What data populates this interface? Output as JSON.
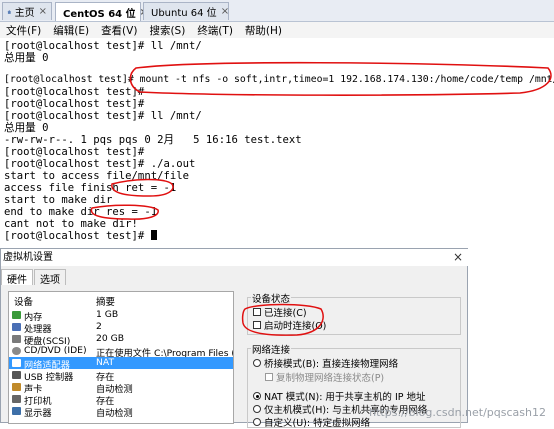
{
  "tabs": [
    {
      "label": "主页",
      "active": false
    },
    {
      "label": "CentOS 64 位",
      "active": true
    },
    {
      "label": "Ubuntu 64 位",
      "active": false
    }
  ],
  "menu": [
    "文件(F)",
    "编辑(E)",
    "查看(V)",
    "搜索(S)",
    "终端(T)",
    "帮助(H)"
  ],
  "terminal": {
    "lines": [
      "[root@localhost test]# ll /mnt/",
      "总用量 0",
      "[root@localhost test]# mount -t nfs -o soft,intr,timeo=1 192.168.174.130:/home/code/temp /mnt/",
      "[root@localhost test]#",
      "[root@localhost test]#",
      "[root@localhost test]# ll /mnt/",
      "总用量 0",
      "-rw-rw-r--. 1 pqs pqs 0 2月   5 16:16 test.text",
      "[root@localhost test]#",
      "[root@localhost test]# ./a.out",
      "start to access file/mnt/file",
      "access file finish ret = -1",
      "start to make dir",
      "end to make dir res = -1",
      "cant not to make dir!",
      "[root@localhost test]# "
    ]
  },
  "dialog": {
    "title": "虚拟机设置",
    "tabs": [
      "硬件",
      "选项"
    ],
    "hardware": {
      "headers": [
        "设备",
        "摘要"
      ],
      "rows": [
        {
          "device": "内存",
          "summary": "1 GB",
          "icon": "memory-icon",
          "color": "#3a9a3a"
        },
        {
          "device": "处理器",
          "summary": "2",
          "icon": "cpu-icon",
          "color": "#4a6fb5"
        },
        {
          "device": "硬盘(SCSI)",
          "summary": "20 GB",
          "icon": "disk-icon",
          "color": "#7a7a7a"
        },
        {
          "device": "CD/DVD (IDE)",
          "summary": "正在使用文件 C:\\Program Files (x86...",
          "icon": "cd-icon",
          "color": "#8a8a8a"
        },
        {
          "device": "网络适配器",
          "summary": "NAT",
          "icon": "network-icon",
          "color": "#2f6bbf",
          "selected": true
        },
        {
          "device": "USB 控制器",
          "summary": "存在",
          "icon": "usb-icon",
          "color": "#555555"
        },
        {
          "device": "声卡",
          "summary": "自动检测",
          "icon": "sound-icon",
          "color": "#c08a2a"
        },
        {
          "device": "打印机",
          "summary": "存在",
          "icon": "printer-icon",
          "color": "#666666"
        },
        {
          "device": "显示器",
          "summary": "自动检测",
          "icon": "monitor-icon",
          "color": "#3d6fa8"
        }
      ]
    },
    "device_status": {
      "title": "设备状态",
      "connected": "已连接(C)",
      "connect_on_power": "启动时连接(O)"
    },
    "network": {
      "title": "网络连接",
      "bridged": "桥接模式(B): 直接连接物理网络",
      "replicate": "复制物理网络连接状态(P)",
      "nat": "NAT 模式(N): 用于共享主机的 IP 地址",
      "hostonly": "仅主机模式(H): 与主机共享的专用网络",
      "custom": "自定义(U): 特定虚拟网络"
    }
  },
  "watermark": "https://blog.csdn.net/pqscash12",
  "colors": {
    "annotation": "#e01010",
    "selection": "#3399ff"
  }
}
